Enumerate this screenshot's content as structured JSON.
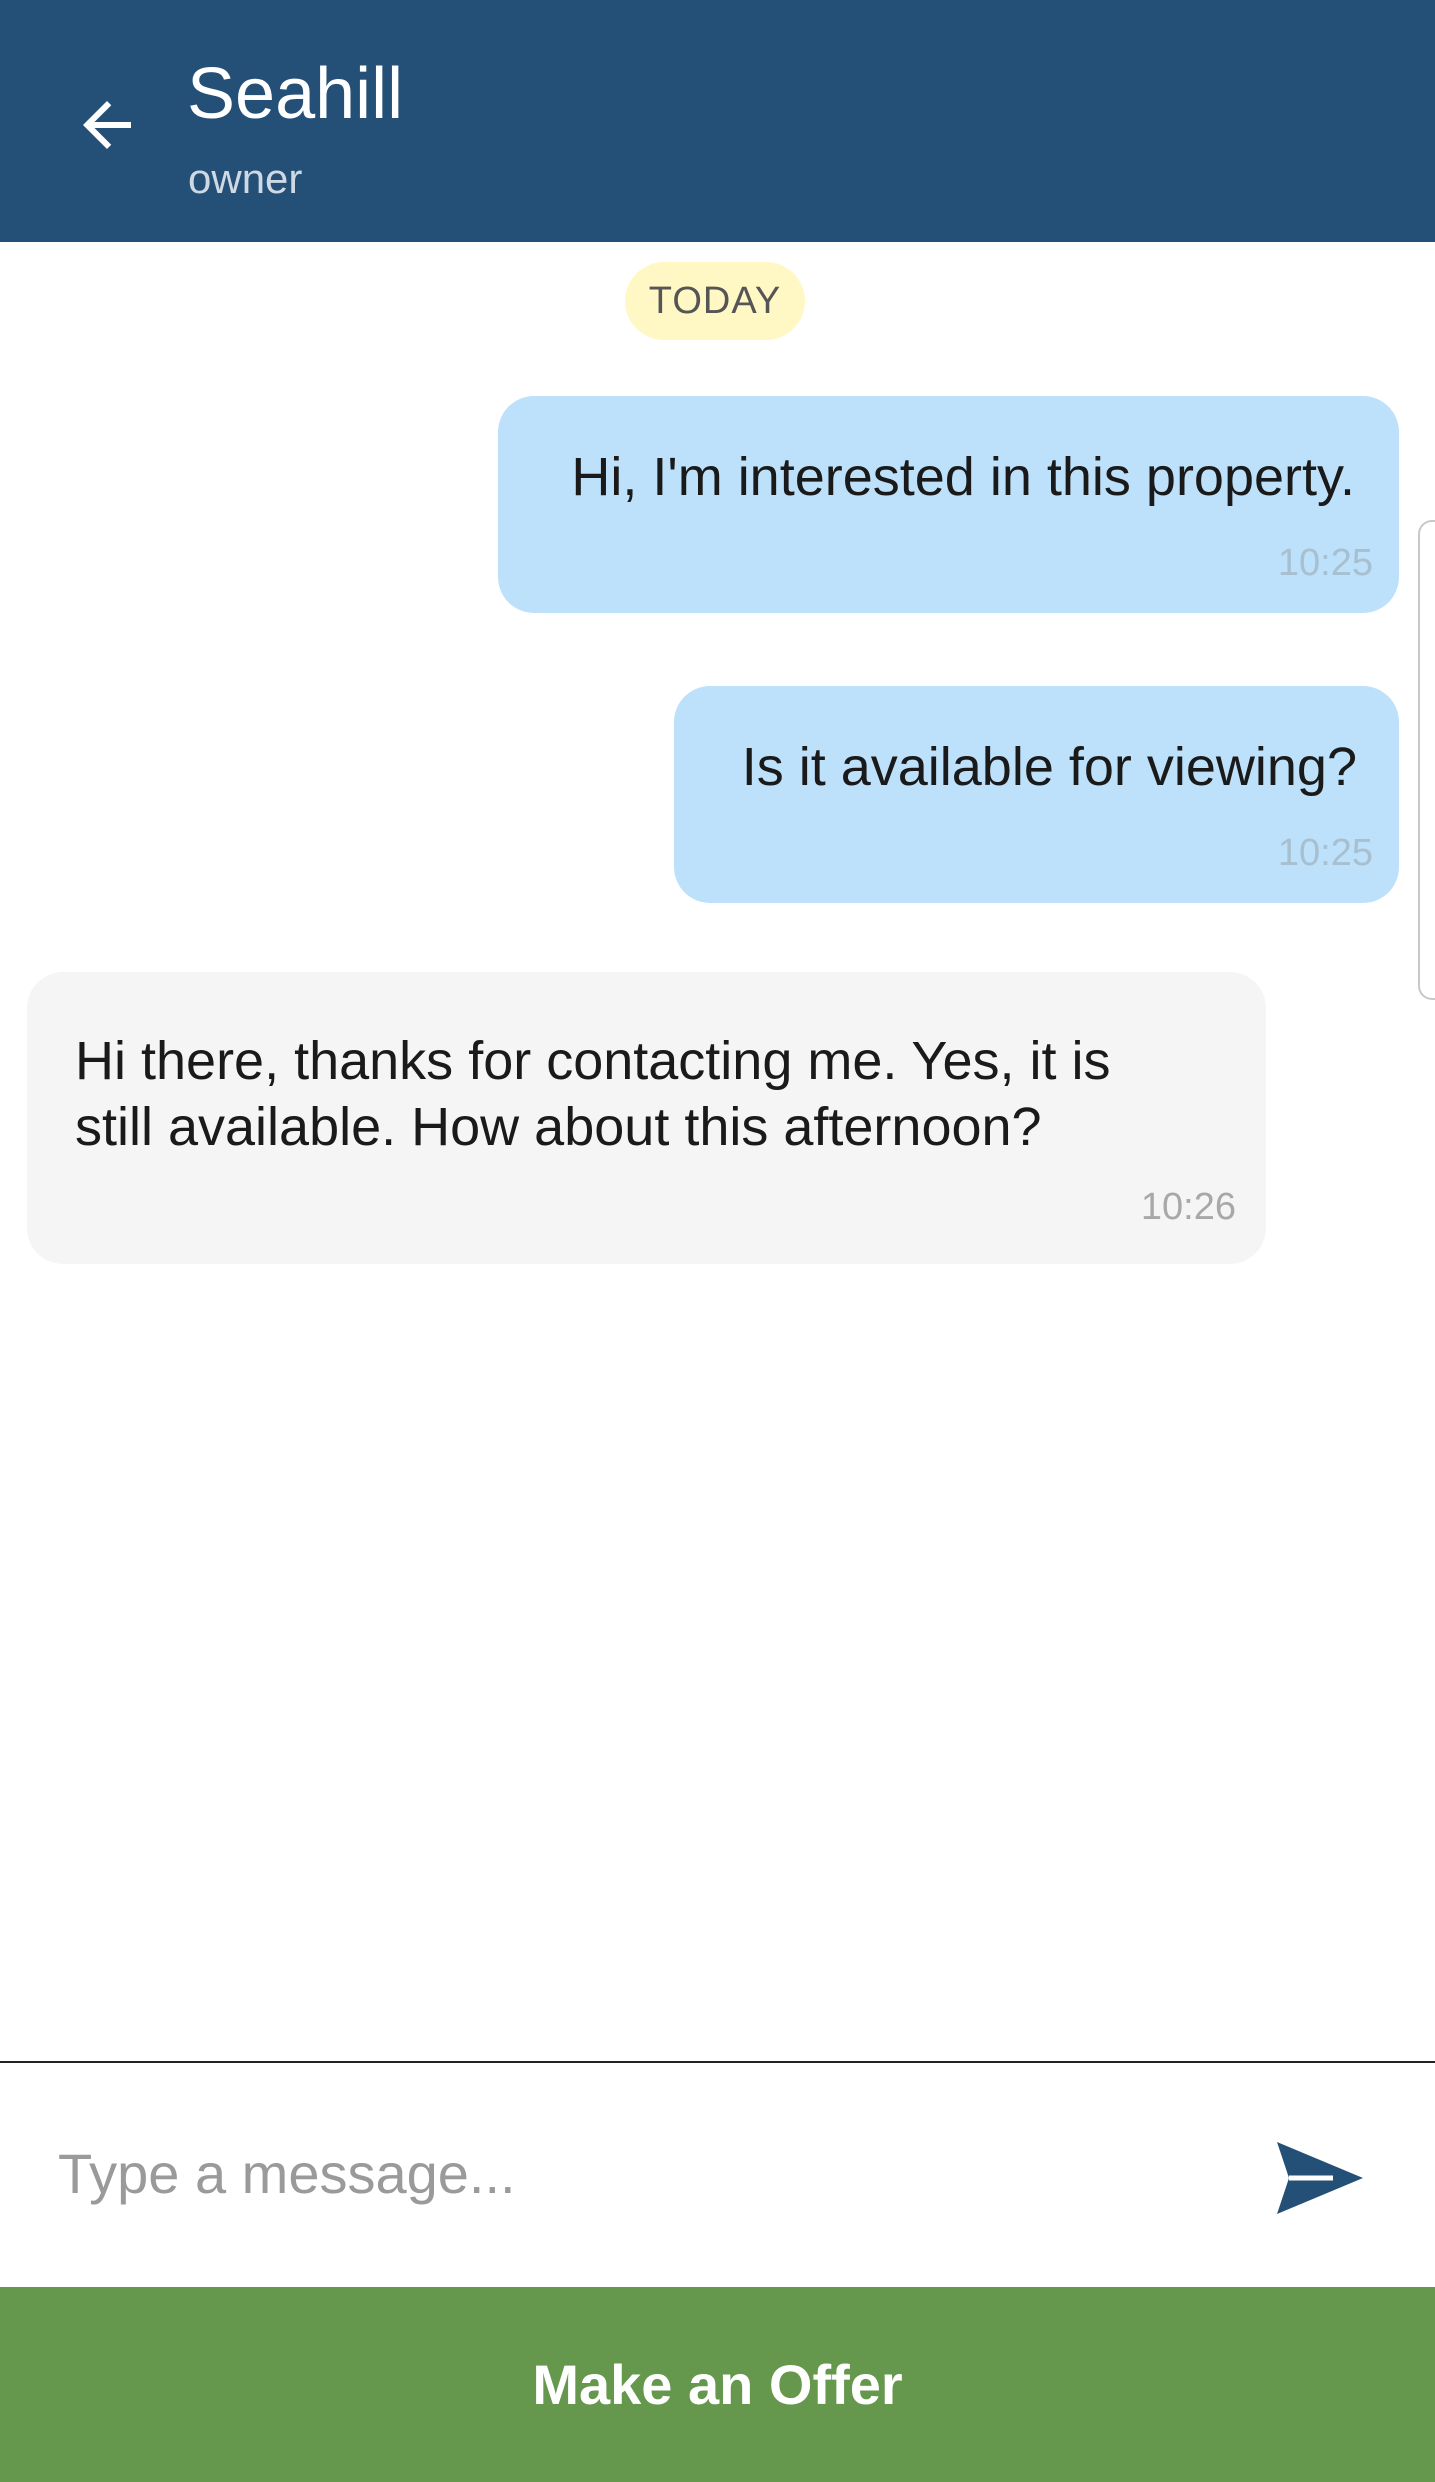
{
  "header": {
    "title": "Seahill",
    "subtitle": "owner",
    "back_icon": "arrow-left-icon"
  },
  "date_separator": "TODAY",
  "messages": [
    {
      "direction": "outgoing",
      "text": "Hi, I'm interested in this property.",
      "time": "10:25"
    },
    {
      "direction": "outgoing",
      "text": "Is it available for viewing?",
      "time": "10:25"
    },
    {
      "direction": "incoming",
      "lines": [
        "Hi there, thanks for contacting me. Yes, it is",
        "still available. How about this afternoon?"
      ],
      "time": "10:26"
    }
  ],
  "composer": {
    "placeholder": "Type a message...",
    "value": "",
    "send_icon": "send-icon"
  },
  "offer_button": "Make an Offer",
  "colors": {
    "header_bg": "#245078",
    "outgoing_bubble": "#bde1fb",
    "incoming_bubble": "#f5f5f5",
    "date_pill": "#fff7c4",
    "send_icon": "#245078",
    "offer_button_bg": "#65984d"
  }
}
